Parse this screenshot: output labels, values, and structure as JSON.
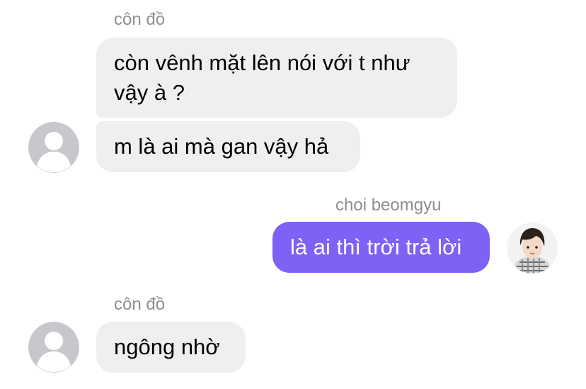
{
  "messages": [
    {
      "sender": "côn đồ",
      "bubbles": [
        "còn vênh mặt lên nói với t như vậy à ?",
        "m là ai mà gan vậy hả"
      ]
    },
    {
      "sender": "choi beomgyu",
      "bubbles": [
        "là ai thì trời trả lời"
      ]
    },
    {
      "sender": "côn đồ",
      "bubbles": [
        "ngông nhờ"
      ]
    }
  ],
  "colors": {
    "incoming_bubble": "#efefef",
    "outgoing_bubble": "#7d62f5",
    "sender_text": "#8e8e93",
    "default_avatar": "#c7c7cc"
  },
  "icons": {
    "default_avatar": "person-placeholder-icon",
    "user_avatar": "profile-photo"
  }
}
